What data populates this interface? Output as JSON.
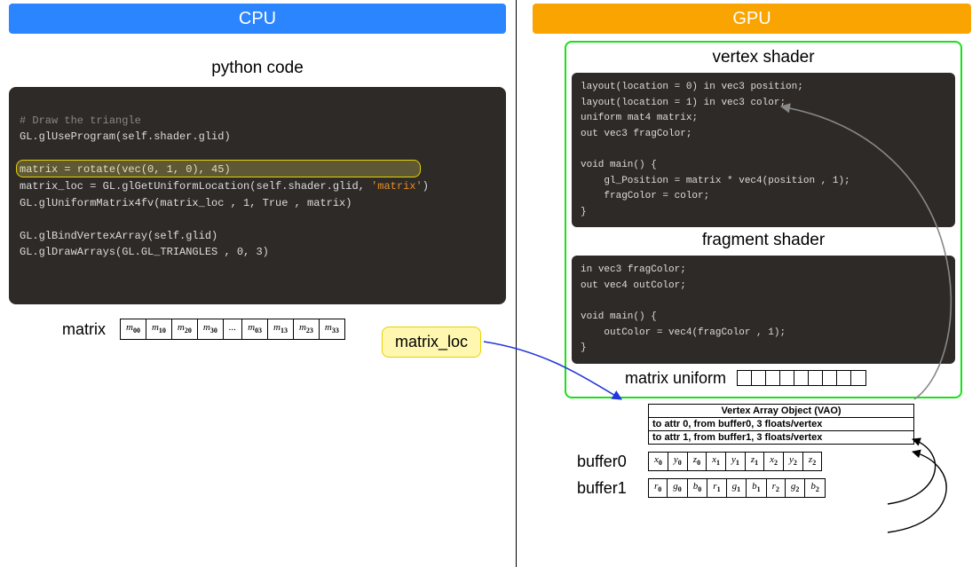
{
  "cpu": {
    "banner": "CPU",
    "section_title": "python code",
    "code": {
      "comment": "# Draw the triangle",
      "l1": "GL.glUseProgram(self.shader.glid)",
      "l2a": "matrix = rotate(vec(0, 1, 0), 45)",
      "l2b_pre": "matrix_loc = GL.glGetUniformLocation(self.shader.glid, ",
      "l2b_str": "'matrix'",
      "l2b_post": ")",
      "l3": "GL.glUniformMatrix4fv(matrix_loc , 1, True , matrix)",
      "l4": "GL.glBindVertexArray(self.glid)",
      "l5": "GL.glDrawArrays(GL.GL_TRIANGLES , 0, 3)"
    },
    "matrix_label": "matrix",
    "matrix_cells": [
      "m00",
      "m10",
      "m20",
      "m30",
      "...",
      "m03",
      "m13",
      "m23",
      "m33"
    ],
    "matrix_loc_label": "matrix_loc"
  },
  "gpu": {
    "banner": "GPU",
    "vertex_title": "vertex shader",
    "fragment_title": "fragment shader",
    "uniform_label": "matrix uniform",
    "vao": {
      "title": "Vertex Array Object (VAO)",
      "rows": [
        "to attr 0, from buffer0, 3 floats/vertex",
        "to attr 1, from buffer1, 3 floats/vertex"
      ]
    },
    "buffer0": {
      "label": "buffer0",
      "cells": [
        "x0",
        "y0",
        "z0",
        "x1",
        "y1",
        "z1",
        "x2",
        "y2",
        "z2"
      ]
    },
    "buffer1": {
      "label": "buffer1",
      "cells": [
        "r0",
        "g0",
        "b0",
        "r1",
        "g1",
        "b1",
        "r2",
        "g2",
        "b2"
      ]
    }
  },
  "vertex_code": {
    "l1": "layout(location = 0) in vec3 position;",
    "l2": "layout(location = 1) in vec3 color;",
    "l3": "uniform mat4 matrix;",
    "l4": "out vec3 fragColor;",
    "l5": "void main() {",
    "l6": "    gl_Position = matrix * vec4(position , 1);",
    "l7": "    fragColor = color;",
    "l8": "}"
  },
  "fragment_code": {
    "l1": "in vec3 fragColor;",
    "l2": "out vec4 outColor;",
    "l3": "void main() {",
    "l4": "    outColor = vec4(fragColor , 1);",
    "l5": "}"
  }
}
